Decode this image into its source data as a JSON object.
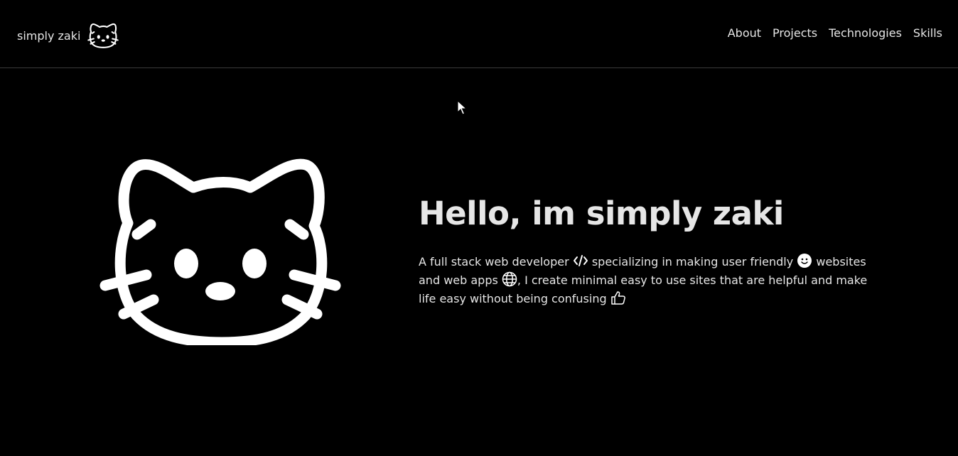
{
  "header": {
    "brand_text": "simply zaki",
    "brand_icon": "cat-face-icon",
    "nav": [
      {
        "label": "About"
      },
      {
        "label": "Projects"
      },
      {
        "label": "Technologies"
      },
      {
        "label": "Skills"
      }
    ]
  },
  "hero": {
    "logo_icon": "cat-face-icon",
    "title": "Hello, im simply zaki",
    "desc_part1": "A full stack web developer",
    "desc_part2": "specializing in making user friendly",
    "desc_part3": "websites and web apps",
    "desc_part4": ", I create minimal easy to use sites that are helpful and make life easy without being confusing",
    "icons": [
      "code-icon",
      "smiley-icon",
      "globe-icon",
      "thumbs-up-icon"
    ]
  },
  "colors": {
    "background": "#000000",
    "text": "#e6e6e6",
    "divider": "#3a3a3a"
  }
}
